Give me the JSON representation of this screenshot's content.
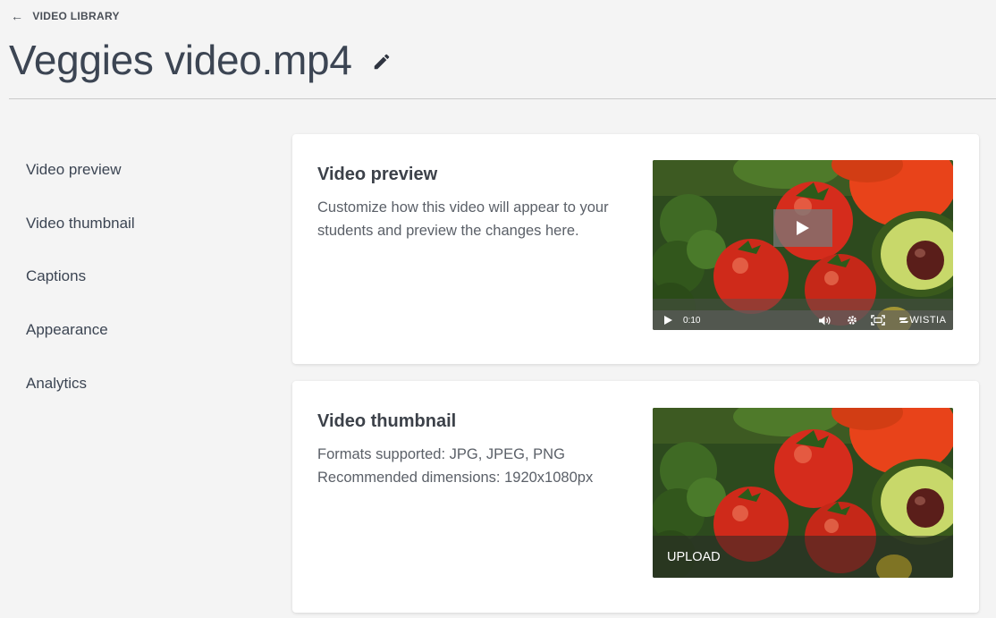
{
  "header": {
    "back_label": "VIDEO LIBRARY",
    "title": "Veggies video.mp4"
  },
  "sidebar": {
    "items": [
      {
        "label": "Video preview"
      },
      {
        "label": "Video thumbnail"
      },
      {
        "label": "Captions"
      },
      {
        "label": "Appearance"
      },
      {
        "label": "Analytics"
      }
    ]
  },
  "preview_card": {
    "title": "Video preview",
    "description": "Customize how this video will appear to your students and preview the changes here.",
    "player": {
      "time": "0:10",
      "brand": "WISTIA"
    }
  },
  "thumbnail_card": {
    "title": "Video thumbnail",
    "formats": "Formats supported: JPG, JPEG, PNG",
    "dimensions": "Recommended dimensions: 1920x1080px",
    "upload_label": "UPLOAD"
  },
  "colors": {
    "background": "#f4f4f4",
    "card": "#ffffff",
    "text": "#3c4553"
  }
}
